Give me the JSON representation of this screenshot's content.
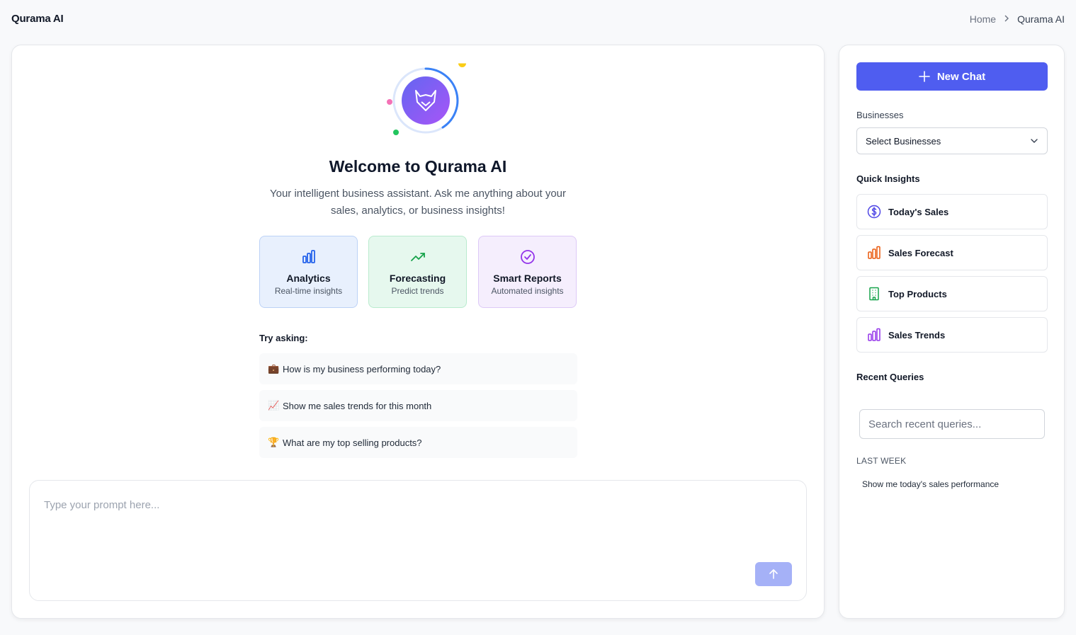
{
  "header": {
    "app_title": "Qurama AI",
    "breadcrumb": {
      "home": "Home",
      "current": "Qurama AI"
    }
  },
  "welcome": {
    "title": "Welcome to Qurama AI",
    "subtitle": "Your intelligent business assistant. Ask me anything about your sales, analytics, or business insights!"
  },
  "features": [
    {
      "title": "Analytics",
      "subtitle": "Real-time insights",
      "icon": "bar-chart-icon",
      "color": "#2563eb"
    },
    {
      "title": "Forecasting",
      "subtitle": "Predict trends",
      "icon": "trending-up-icon",
      "color": "#16a34a"
    },
    {
      "title": "Smart Reports",
      "subtitle": "Automated insights",
      "icon": "check-circle-icon",
      "color": "#9333ea"
    }
  ],
  "try_asking": {
    "label": "Try asking:",
    "suggestions": [
      {
        "emoji": "💼",
        "text": "How is my business performing today?"
      },
      {
        "emoji": "📈",
        "text": "Show me sales trends for this month"
      },
      {
        "emoji": "🏆",
        "text": "What are my top selling products?"
      }
    ]
  },
  "prompt": {
    "placeholder": "Type your prompt here...",
    "value": ""
  },
  "sidebar": {
    "new_chat_label": "New Chat",
    "businesses_label": "Businesses",
    "businesses_select": "Select Businesses",
    "quick_insights_heading": "Quick Insights",
    "insights": [
      {
        "label": "Today's Sales",
        "icon": "dollar-circle-icon",
        "color": "#4f46e5"
      },
      {
        "label": "Sales Forecast",
        "icon": "bar-chart-icon",
        "color": "#ea580c"
      },
      {
        "label": "Top Products",
        "icon": "building-icon",
        "color": "#16a34a"
      },
      {
        "label": "Sales Trends",
        "icon": "bar-chart-icon",
        "color": "#9333ea"
      }
    ],
    "recent_heading": "Recent Queries",
    "search_placeholder": "Search recent queries...",
    "recent_group": "LAST WEEK",
    "recent_items": [
      "Show me today's sales performance"
    ]
  },
  "colors": {
    "primary": "#4f5df0",
    "send_button": "#a5b1f7",
    "logo_gradient_start": "#6366f1",
    "logo_gradient_end": "#a855f7"
  }
}
